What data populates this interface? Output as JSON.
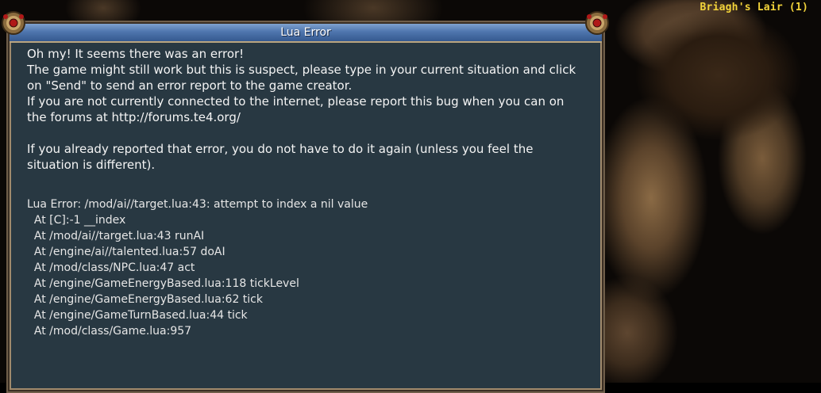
{
  "zone": {
    "name": "Briagh's Lair (1)"
  },
  "dialog": {
    "title": "Lua Error",
    "message": [
      "Oh my! It seems there was an error!",
      "The game might still work but this is suspect, please type in your current situation and click on \"Send\" to send an error report to the game creator.",
      "If you are not currently connected to the internet, please report this bug when you can on the forums at http://forums.te4.org/",
      "",
      "If you already reported that error, you do not have to do it again (unless you feel the situation is different)."
    ],
    "traceback": [
      "Lua Error: /mod/ai//target.lua:43: attempt to index a nil value",
      "  At [C]:-1 __index",
      "  At /mod/ai//target.lua:43 runAI",
      "  At /engine/ai//talented.lua:57 doAI",
      "  At /mod/class/NPC.lua:47 act",
      "  At /engine/GameEnergyBased.lua:118 tickLevel",
      "  At /engine/GameEnergyBased.lua:62 tick",
      "  At /engine/GameTurnBased.lua:44 tick",
      "  At /mod/class/Game.lua:957"
    ]
  },
  "colors": {
    "dialog_bg": "#283842",
    "titlebar": "#4f76ae",
    "zone_name": "#f2d33a",
    "text": "#f4f4f4"
  },
  "icons": [
    "gem-ornament-icon"
  ]
}
